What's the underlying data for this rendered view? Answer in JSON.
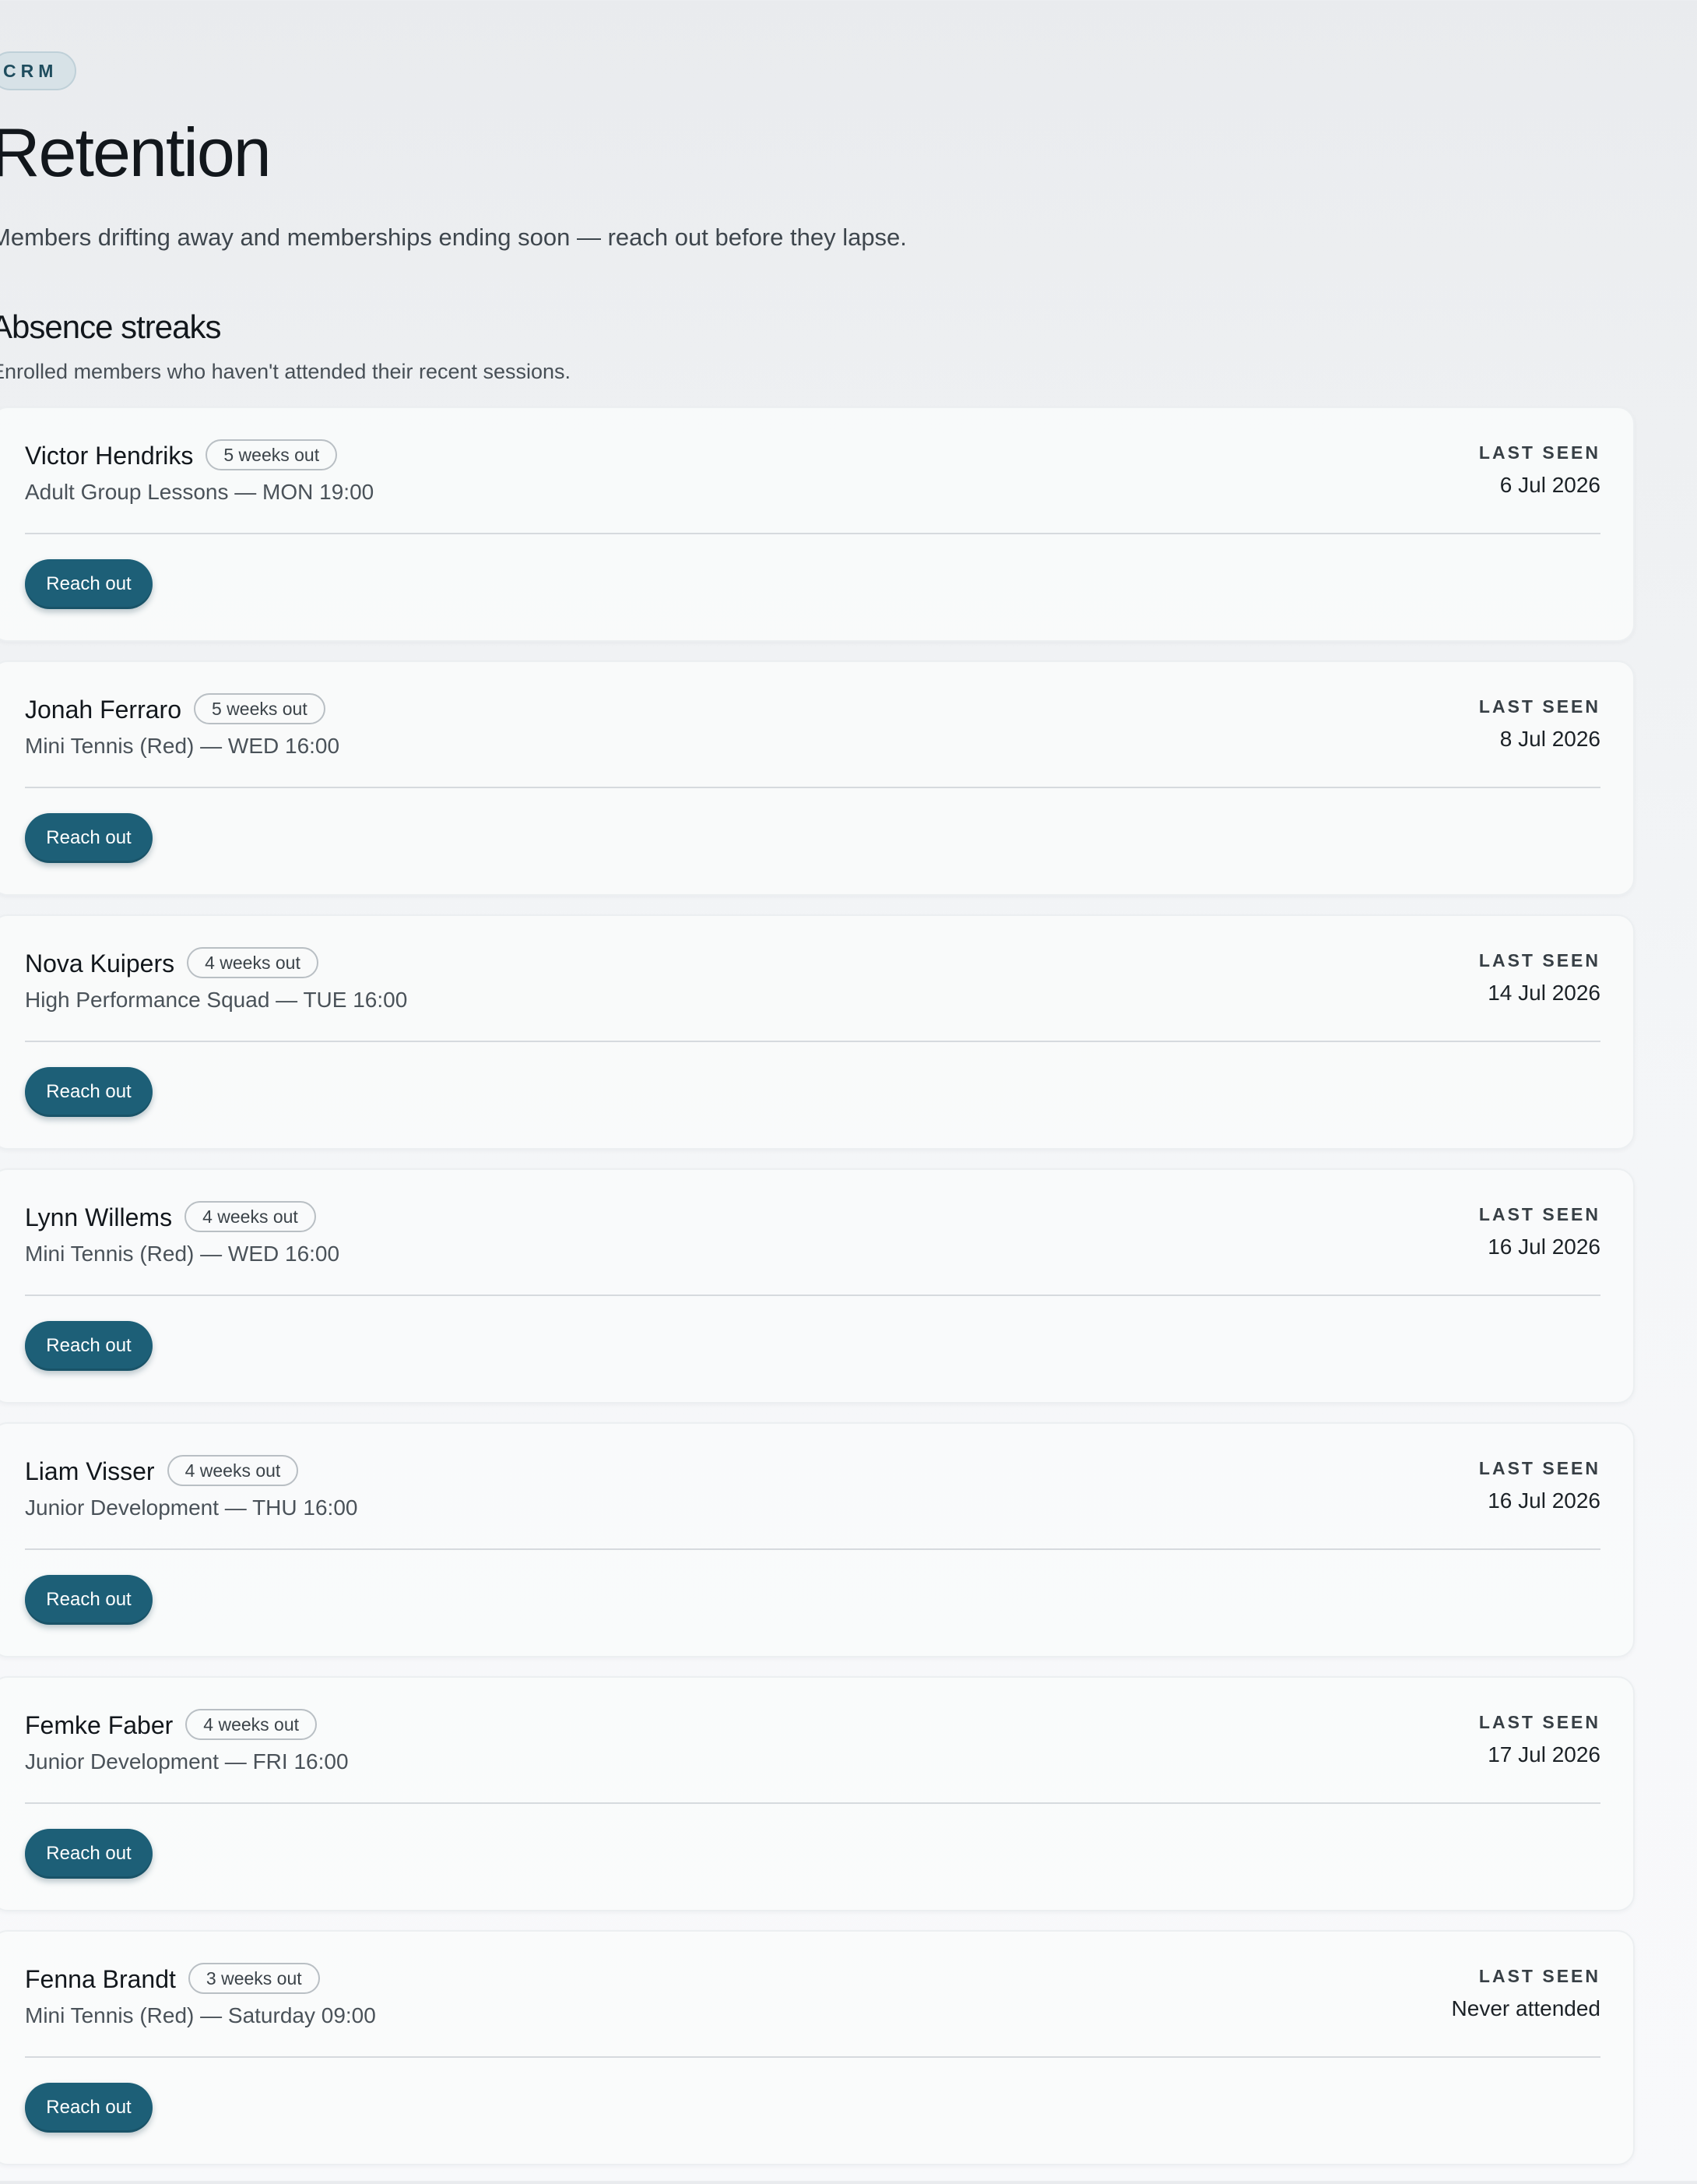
{
  "header": {
    "badge": "CRM",
    "title": "Retention",
    "subtitle": "Members drifting away and memberships ending soon — reach out before they lapse."
  },
  "section": {
    "title": "Absence streaks",
    "description": "Enrolled members who haven't attended their recent sessions.",
    "last_seen_label": "LAST SEEN",
    "action_label": "Reach out"
  },
  "members": [
    {
      "name": "Victor Hendriks",
      "weeks": "5 weeks out",
      "session": "Adult Group Lessons — MON 19:00",
      "last_seen": "6 Jul 2026"
    },
    {
      "name": "Jonah Ferraro",
      "weeks": "5 weeks out",
      "session": "Mini Tennis (Red) — WED 16:00",
      "last_seen": "8 Jul 2026"
    },
    {
      "name": "Nova Kuipers",
      "weeks": "4 weeks out",
      "session": "High Performance Squad — TUE 16:00",
      "last_seen": "14 Jul 2026"
    },
    {
      "name": "Lynn Willems",
      "weeks": "4 weeks out",
      "session": "Mini Tennis (Red) — WED 16:00",
      "last_seen": "16 Jul 2026"
    },
    {
      "name": "Liam Visser",
      "weeks": "4 weeks out",
      "session": "Junior Development — THU 16:00",
      "last_seen": "16 Jul 2026"
    },
    {
      "name": "Femke Faber",
      "weeks": "4 weeks out",
      "session": "Junior Development — FRI 16:00",
      "last_seen": "17 Jul 2026"
    },
    {
      "name": "Fenna Brandt",
      "weeks": "3 weeks out",
      "session": "Mini Tennis (Red) — Saturday 09:00",
      "last_seen": "Never attended"
    }
  ]
}
